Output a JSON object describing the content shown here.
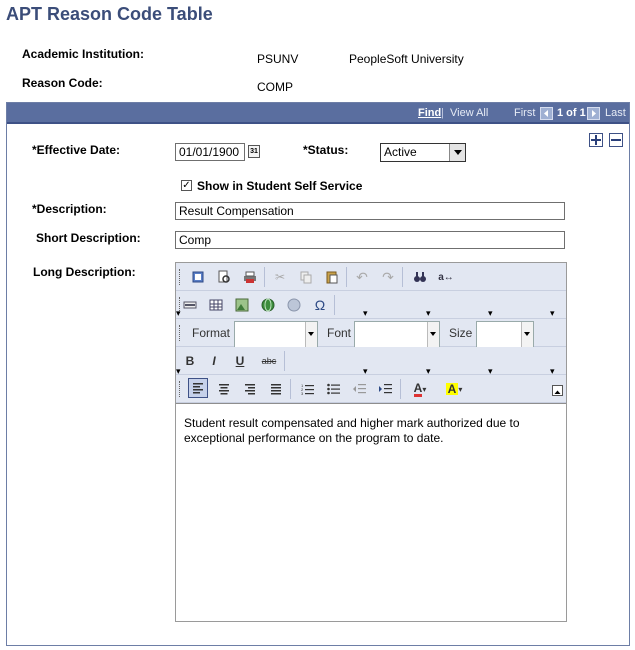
{
  "page": {
    "title": "APT Reason Code Table"
  },
  "header": {
    "institution_label": "Academic Institution:",
    "institution_code": "PSUNV",
    "institution_name": "PeopleSoft University",
    "reason_label": "Reason Code:",
    "reason_value": "COMP"
  },
  "nav": {
    "find": "Find",
    "view_all": "View All",
    "first": "First",
    "count": "1 of 1",
    "last": "Last"
  },
  "form": {
    "effective_date_label": "*Effective Date:",
    "effective_date_value": "01/01/1900",
    "calendar_icon_text": "31",
    "status_label": "*Status:",
    "status_value": "Active",
    "self_service_label": "Show in Student Self Service",
    "self_service_checked": "✓",
    "description_label": "*Description:",
    "description_value": "Result Compensation",
    "short_description_label": "Short Description:",
    "short_description_value": "Comp",
    "long_description_label": "Long Description:"
  },
  "editor": {
    "format_label": "Format",
    "font_label": "Font",
    "size_label": "Size",
    "bold": "B",
    "italic": "I",
    "underline": "U",
    "strike": "abc",
    "content": "Student result compensated and higher mark authorized due to exceptional performance on the program to date."
  },
  "colors": {
    "header_bar": "#5a6e9f",
    "title": "#3b4d79",
    "toolbar": "#e2e7f2"
  }
}
